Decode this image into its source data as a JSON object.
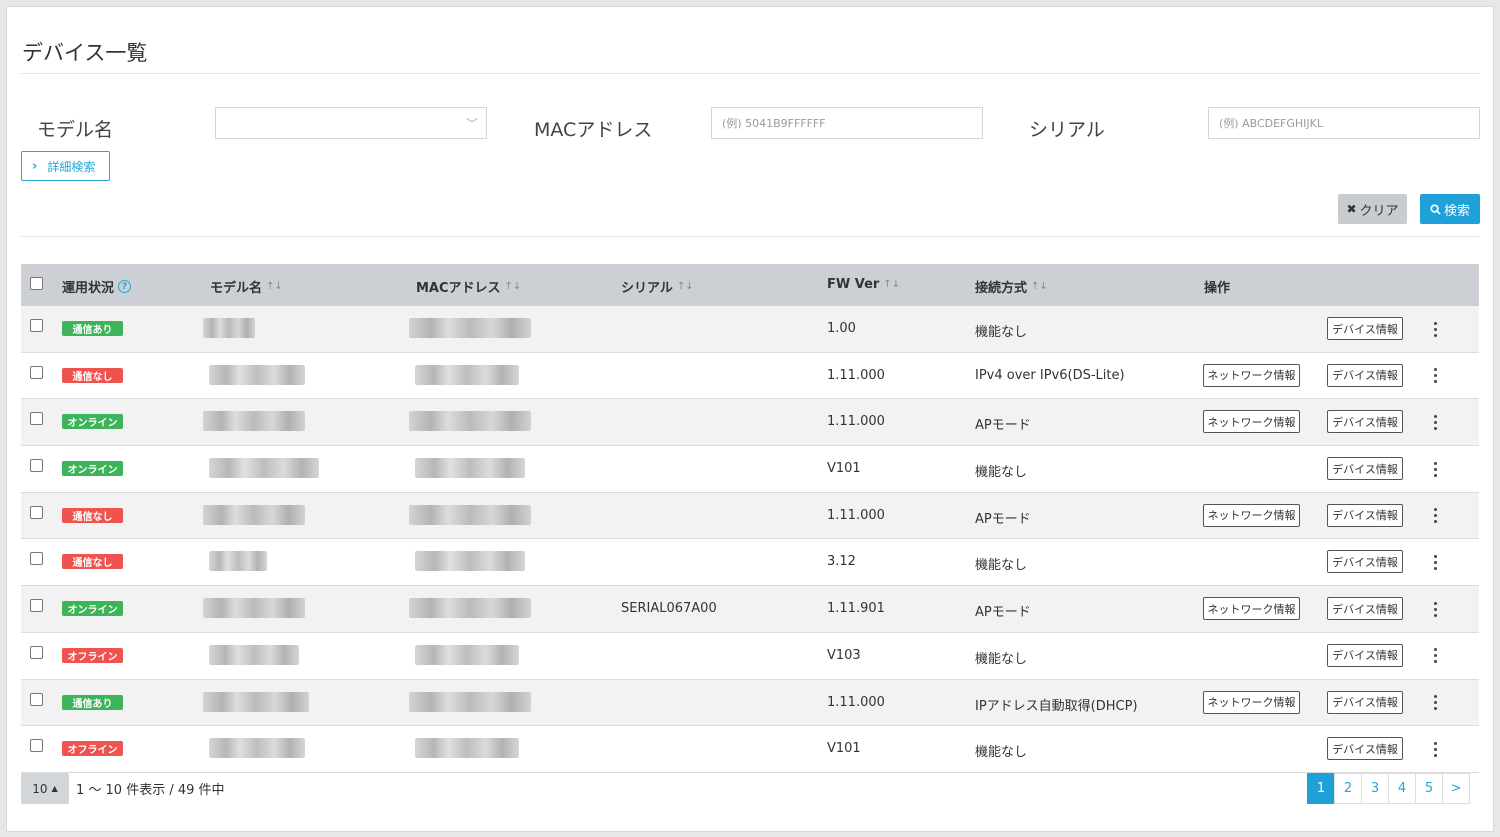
{
  "page_title": "デバイス一覧",
  "filters": {
    "model_label": "モデル名",
    "model_value": "",
    "mac_label": "MACアドレス",
    "mac_placeholder": "(例) 5041B9FFFFFF",
    "serial_label": "シリアル",
    "serial_placeholder": "(例) ABCDEFGHIJKL",
    "advanced_search": "詳細検索",
    "clear": "クリア",
    "search": "検索"
  },
  "table": {
    "headers": {
      "status": "運用状況",
      "model": "モデル名",
      "mac": "MACアドレス",
      "serial": "シリアル",
      "fw": "FW Ver",
      "connection": "接続方式",
      "ops": "操作"
    },
    "network_button": "ネットワーク情報",
    "device_button": "デバイス情報",
    "rows": [
      {
        "status": "通信あり",
        "status_color": "#3db35a",
        "serial": "",
        "fw": "1.00",
        "connection": "機能なし",
        "has_network": false
      },
      {
        "status": "通信なし",
        "status_color": "#ef5350",
        "serial": "",
        "fw": "1.11.000",
        "connection": "IPv4 over IPv6(DS-Lite)",
        "has_network": true
      },
      {
        "status": "オンライン",
        "status_color": "#3db35a",
        "serial": "",
        "fw": "1.11.000",
        "connection": "APモード",
        "has_network": true
      },
      {
        "status": "オンライン",
        "status_color": "#3db35a",
        "serial": "",
        "fw": "V101",
        "connection": "機能なし",
        "has_network": false
      },
      {
        "status": "通信なし",
        "status_color": "#ef5350",
        "serial": "",
        "fw": "1.11.000",
        "connection": "APモード",
        "has_network": true
      },
      {
        "status": "通信なし",
        "status_color": "#ef5350",
        "serial": "",
        "fw": "3.12",
        "connection": "機能なし",
        "has_network": false
      },
      {
        "status": "オンライン",
        "status_color": "#3db35a",
        "serial": "SERIAL067A00",
        "fw": "1.11.901",
        "connection": "APモード",
        "has_network": true
      },
      {
        "status": "オフライン",
        "status_color": "#ef5350",
        "serial": "",
        "fw": "V103",
        "connection": "機能なし",
        "has_network": false
      },
      {
        "status": "通信あり",
        "status_color": "#3db35a",
        "serial": "",
        "fw": "1.11.000",
        "connection": "IPアドレス自動取得(DHCP)",
        "has_network": true
      },
      {
        "status": "オフライン",
        "status_color": "#ef5350",
        "serial": "",
        "fw": "V101",
        "connection": "機能なし",
        "has_network": false
      }
    ]
  },
  "footer": {
    "per_page": "10",
    "info": "1 〜 10 件表示 / 49 件中",
    "pages": [
      "1",
      "2",
      "3",
      "4",
      "5",
      ">"
    ],
    "active_page": "1"
  },
  "colors": {
    "accent": "#20a0d8",
    "online": "#3db35a",
    "offline": "#ef5350",
    "header_bg": "#ccd0d5"
  }
}
